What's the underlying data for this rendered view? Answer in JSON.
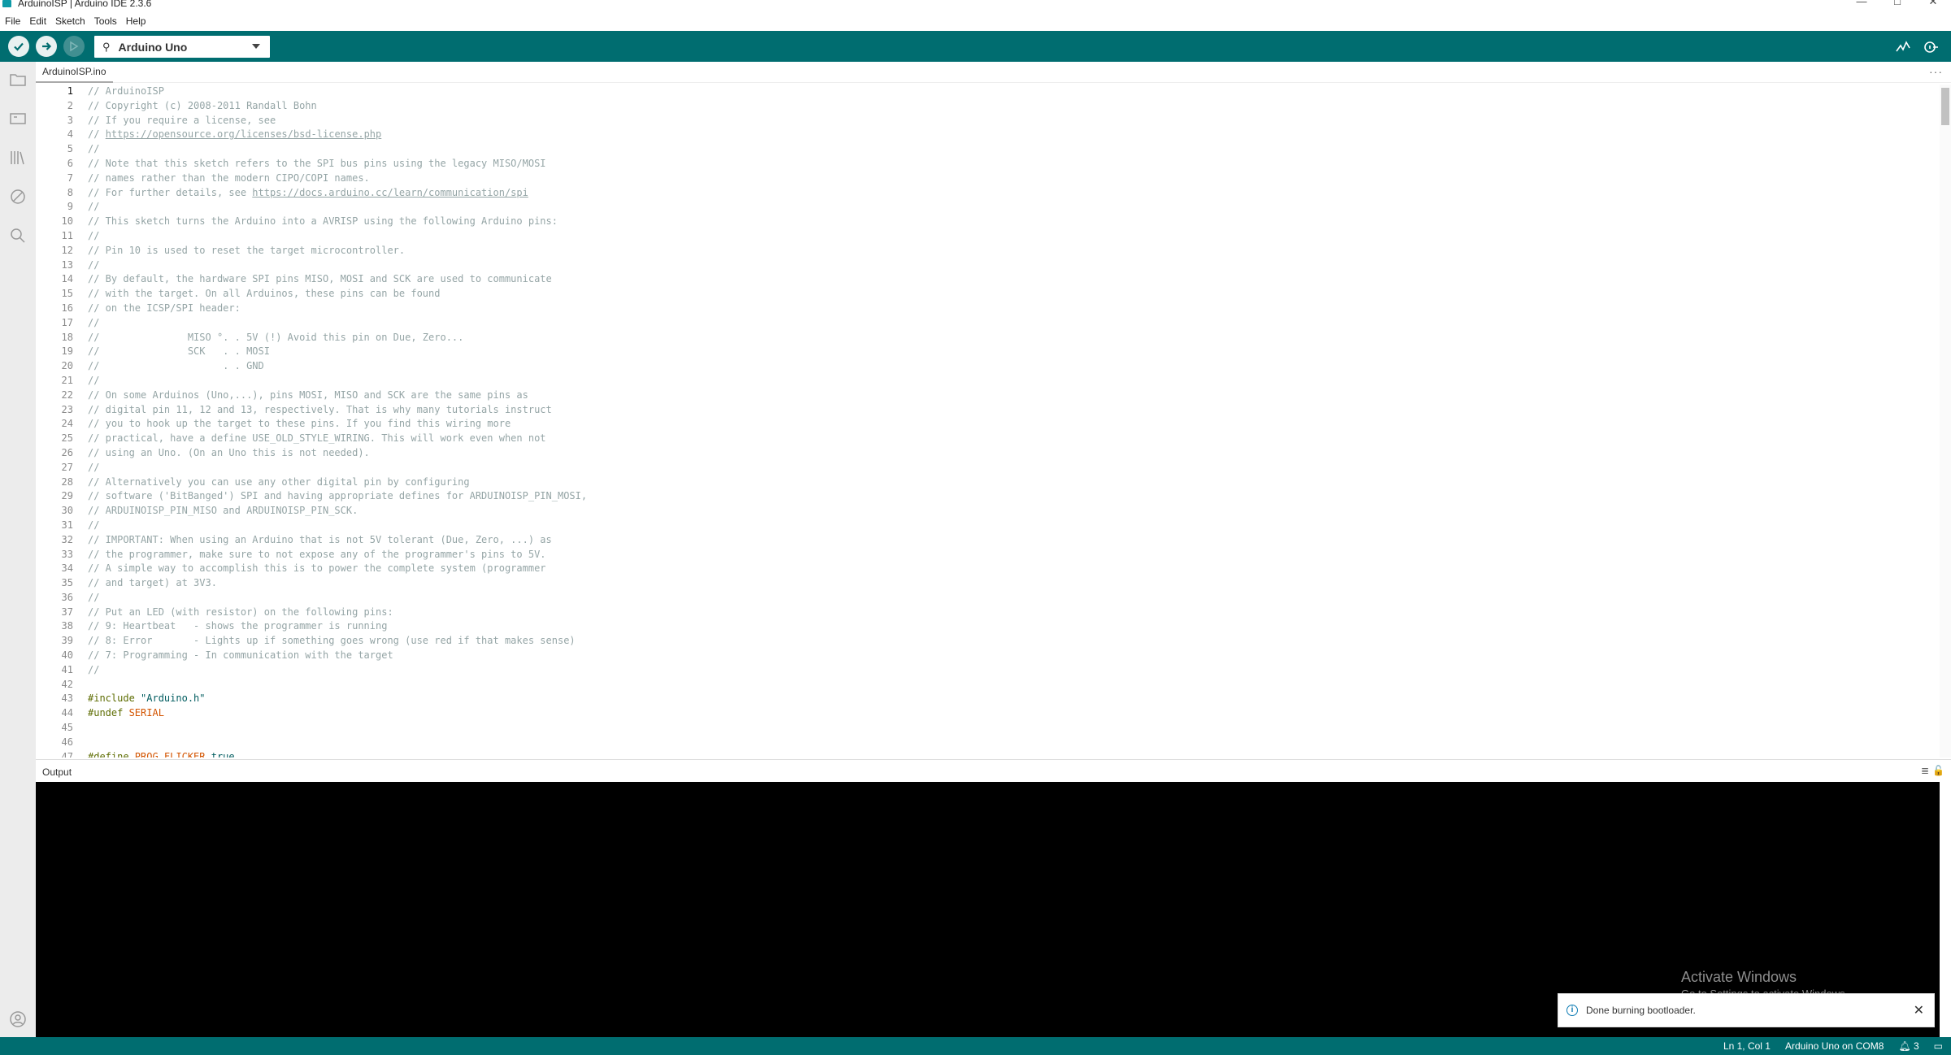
{
  "window": {
    "title": "ArduinoISP | Arduino IDE 2.3.6",
    "controls": [
      "—",
      "□",
      "✕"
    ]
  },
  "menu": [
    "File",
    "Edit",
    "Sketch",
    "Tools",
    "Help"
  ],
  "toolbar": {
    "board": "Arduino Uno"
  },
  "tabs": [
    {
      "label": "ArduinoISP.ino"
    }
  ],
  "tab_more": "···",
  "editor": {
    "lines": [
      {
        "n": "1",
        "text": "// ArduinoISP"
      },
      {
        "n": "2",
        "text": "// Copyright (c) 2008-2011 Randall Bohn"
      },
      {
        "n": "3",
        "text": "// If you require a license, see"
      },
      {
        "n": "4",
        "text": "// ",
        "link": "https://opensource.org/licenses/bsd-license.php"
      },
      {
        "n": "5",
        "text": "//"
      },
      {
        "n": "6",
        "text": "// Note that this sketch refers to the SPI bus pins using the legacy MISO/MOSI"
      },
      {
        "n": "7",
        "text": "// names rather than the modern CIPO/COPI names."
      },
      {
        "n": "8",
        "text": "// For further details, see ",
        "link": "https://docs.arduino.cc/learn/communication/spi"
      },
      {
        "n": "9",
        "text": "//"
      },
      {
        "n": "10",
        "text": "// This sketch turns the Arduino into a AVRISP using the following Arduino pins:"
      },
      {
        "n": "11",
        "text": "//"
      },
      {
        "n": "12",
        "text": "// Pin 10 is used to reset the target microcontroller."
      },
      {
        "n": "13",
        "text": "//"
      },
      {
        "n": "14",
        "text": "// By default, the hardware SPI pins MISO, MOSI and SCK are used to communicate"
      },
      {
        "n": "15",
        "text": "// with the target. On all Arduinos, these pins can be found"
      },
      {
        "n": "16",
        "text": "// on the ICSP/SPI header:"
      },
      {
        "n": "17",
        "text": "//"
      },
      {
        "n": "18",
        "text": "//               MISO °. . 5V (!) Avoid this pin on Due, Zero..."
      },
      {
        "n": "19",
        "text": "//               SCK   . . MOSI"
      },
      {
        "n": "20",
        "text": "//                     . . GND"
      },
      {
        "n": "21",
        "text": "//"
      },
      {
        "n": "22",
        "text": "// On some Arduinos (Uno,...), pins MOSI, MISO and SCK are the same pins as"
      },
      {
        "n": "23",
        "text": "// digital pin 11, 12 and 13, respectively. That is why many tutorials instruct"
      },
      {
        "n": "24",
        "text": "// you to hook up the target to these pins. If you find this wiring more"
      },
      {
        "n": "25",
        "text": "// practical, have a define USE_OLD_STYLE_WIRING. This will work even when not"
      },
      {
        "n": "26",
        "text": "// using an Uno. (On an Uno this is not needed)."
      },
      {
        "n": "27",
        "text": "//"
      },
      {
        "n": "28",
        "text": "// Alternatively you can use any other digital pin by configuring"
      },
      {
        "n": "29",
        "text": "// software ('BitBanged') SPI and having appropriate defines for ARDUINOISP_PIN_MOSI,"
      },
      {
        "n": "30",
        "text": "// ARDUINOISP_PIN_MISO and ARDUINOISP_PIN_SCK."
      },
      {
        "n": "31",
        "text": "//"
      },
      {
        "n": "32",
        "text": "// IMPORTANT: When using an Arduino that is not 5V tolerant (Due, Zero, ...) as"
      },
      {
        "n": "33",
        "text": "// the programmer, make sure to not expose any of the programmer's pins to 5V."
      },
      {
        "n": "34",
        "text": "// A simple way to accomplish this is to power the complete system (programmer"
      },
      {
        "n": "35",
        "text": "// and target) at 3V3."
      },
      {
        "n": "36",
        "text": "//"
      },
      {
        "n": "37",
        "text": "// Put an LED (with resistor) on the following pins:"
      },
      {
        "n": "38",
        "text": "// 9: Heartbeat   - shows the programmer is running"
      },
      {
        "n": "39",
        "text": "// 8: Error       - Lights up if something goes wrong (use red if that makes sense)"
      },
      {
        "n": "40",
        "text": "// 7: Programming - In communication with the target"
      },
      {
        "n": "41",
        "text": "//"
      },
      {
        "n": "42",
        "text": ""
      },
      {
        "n": "43",
        "kw": "#include ",
        "str": "\"Arduino.h\""
      },
      {
        "n": "44",
        "kw": "#undef ",
        "red": "SERIAL"
      },
      {
        "n": "45",
        "text": ""
      },
      {
        "n": "46",
        "text": ""
      },
      {
        "n": "47",
        "kw": "#define ",
        "red": "PROG_FLICKER ",
        "str": "true"
      }
    ]
  },
  "output": {
    "title": "Output",
    "icons": [
      "≣",
      "🔓"
    ]
  },
  "watermark": {
    "line1": "Activate Windows",
    "line2": "Go to Settings to activate Windows."
  },
  "toast": {
    "message": "Done burning bootloader.",
    "close": "✕",
    "info": "i"
  },
  "status": {
    "cursor": "Ln 1, Col 1",
    "board_port": "Arduino Uno on COM8",
    "notifications": "3"
  }
}
